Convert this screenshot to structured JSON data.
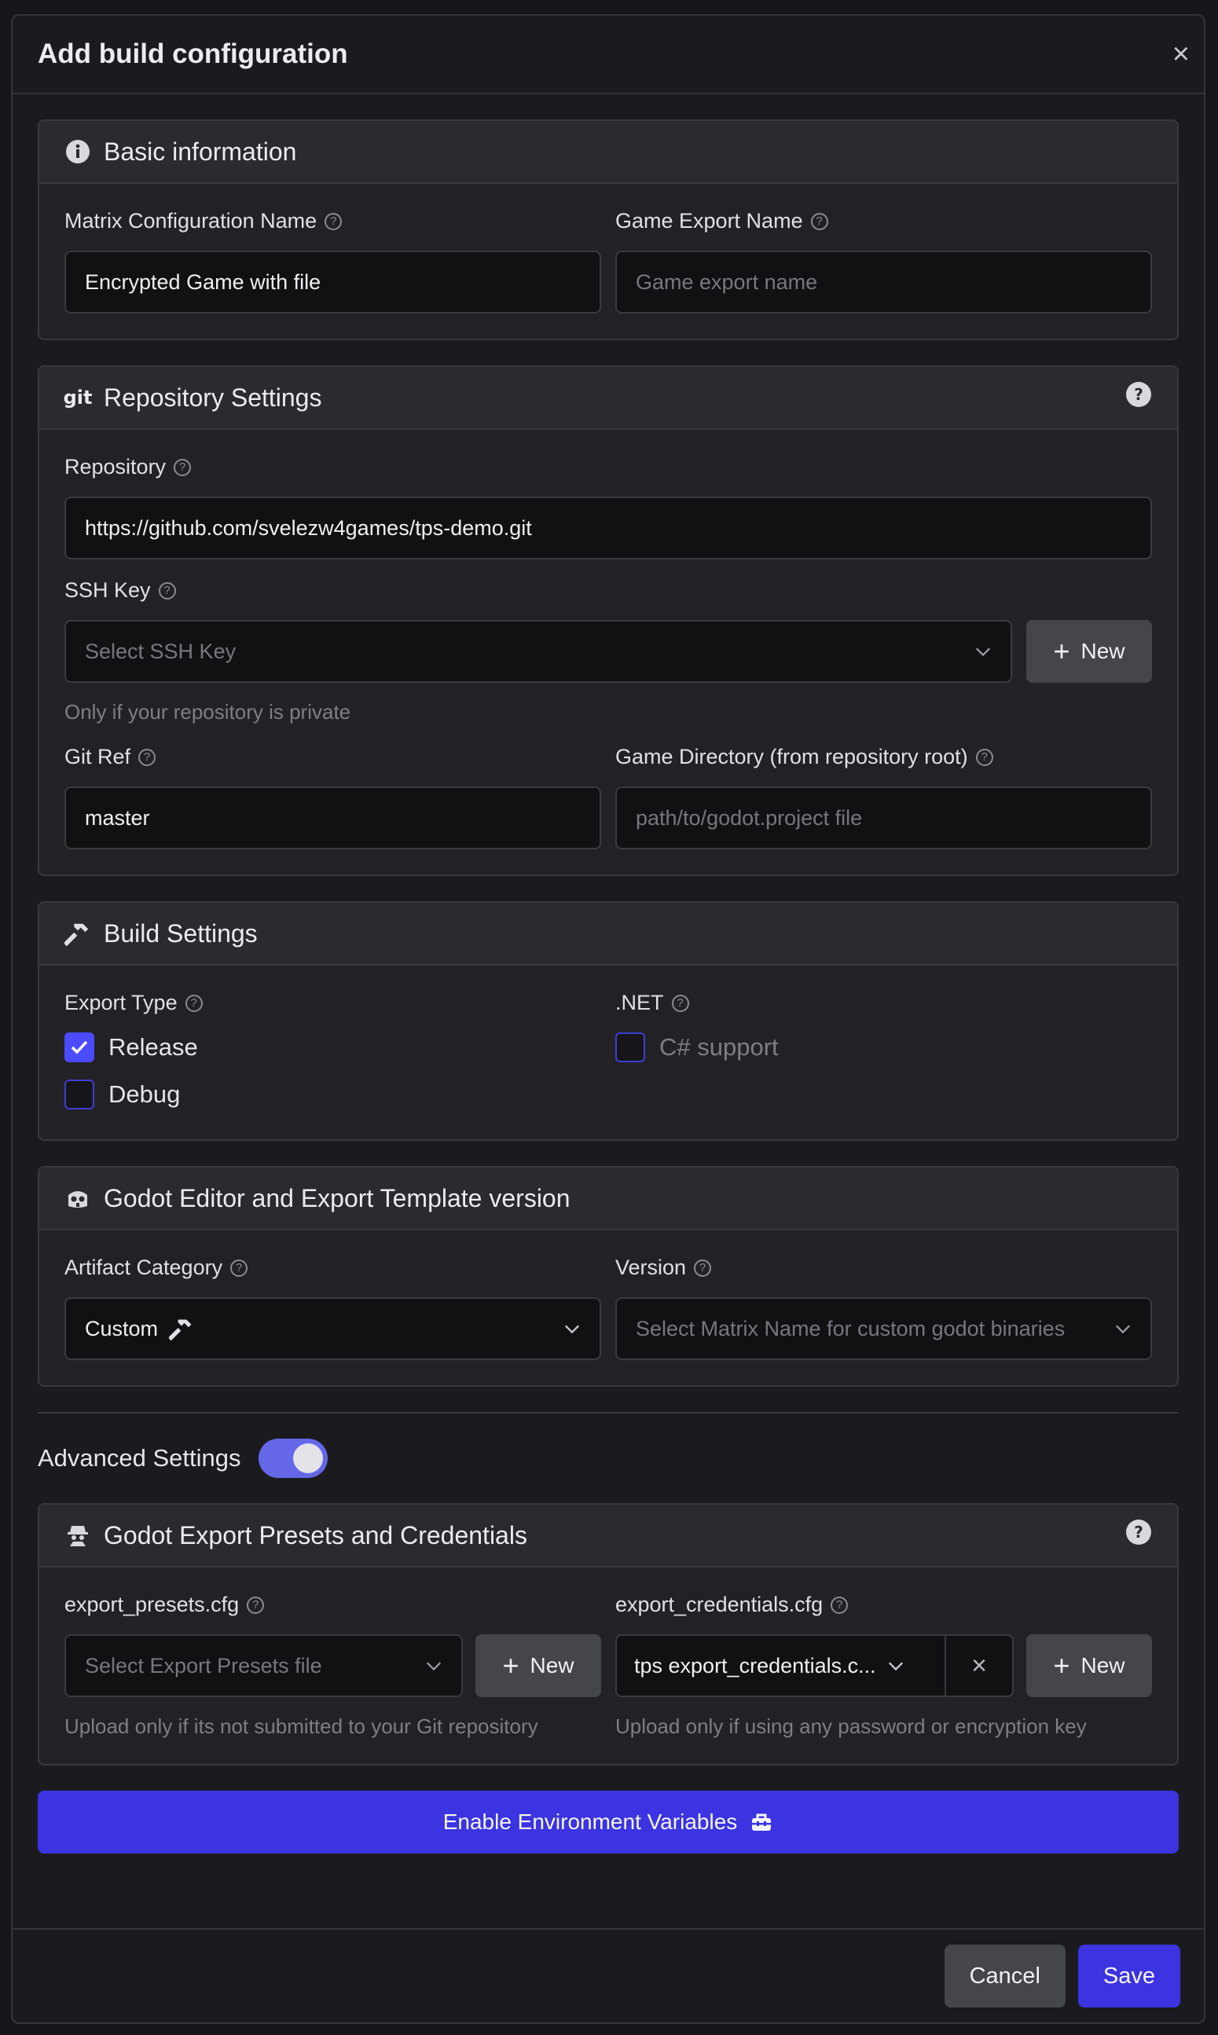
{
  "modal": {
    "title": "Add build configuration",
    "close": "×"
  },
  "basic": {
    "title": "Basic information",
    "matrix_label": "Matrix Configuration Name",
    "matrix_value": "Encrypted Game with file",
    "export_label": "Game Export Name",
    "export_placeholder": "Game export name"
  },
  "repo": {
    "title": "Repository Settings",
    "icon_text": "git",
    "repository_label": "Repository",
    "repository_value": "https://github.com/svelezw4games/tps-demo.git",
    "ssh_label": "SSH Key",
    "ssh_placeholder": "Select SSH Key",
    "new_label": "New",
    "ssh_hint": "Only if your repository is private",
    "gitref_label": "Git Ref",
    "gitref_value": "master",
    "gamedir_label": "Game Directory (from repository root)",
    "gamedir_placeholder": "path/to/godot.project file"
  },
  "build": {
    "title": "Build Settings",
    "export_type_label": "Export Type",
    "release_label": "Release",
    "release_checked": true,
    "debug_label": "Debug",
    "debug_checked": false,
    "net_label": ".NET",
    "csharp_label": "C# support",
    "csharp_checked": false
  },
  "godot": {
    "title": "Godot Editor and Export Template version",
    "artifact_label": "Artifact Category",
    "artifact_value": "Custom",
    "version_label": "Version",
    "version_placeholder": "Select Matrix Name for custom godot binaries"
  },
  "advanced": {
    "label": "Advanced Settings",
    "enabled": true
  },
  "presets": {
    "title": "Godot Export Presets and Credentials",
    "presets_label": "export_presets.cfg",
    "presets_placeholder": "Select Export Presets file",
    "new_label": "New",
    "presets_hint": "Upload only if its not submitted to your Git repository",
    "creds_label": "export_credentials.cfg",
    "creds_value": "tps export_credentials.c...",
    "clear": "×",
    "creds_hint": "Upload only if using any password or encryption key"
  },
  "env_button": "Enable Environment Variables",
  "footer": {
    "cancel": "Cancel",
    "save": "Save"
  },
  "colors": {
    "accent": "#3b34e0",
    "checkbox": "#4b4bff",
    "toggle": "#6468e8"
  }
}
